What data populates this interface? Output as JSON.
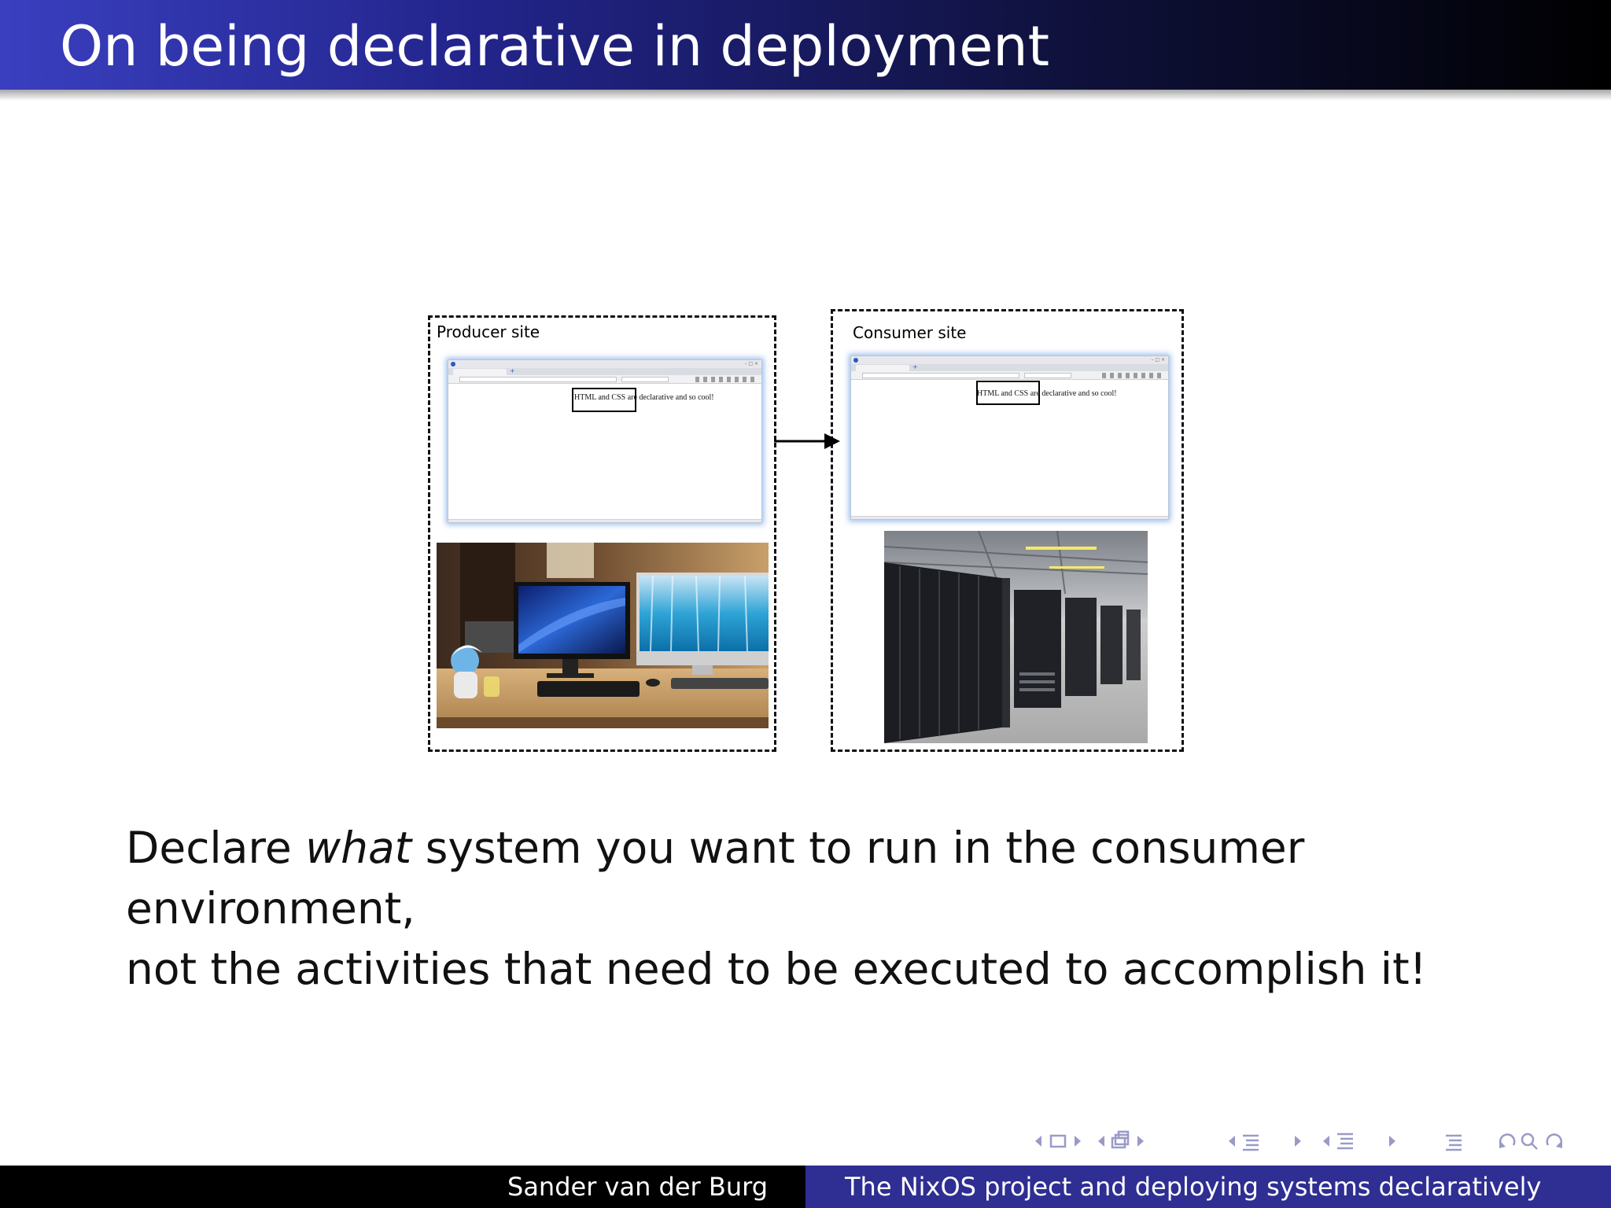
{
  "slide": {
    "title": "On being declarative in deployment"
  },
  "diagram": {
    "producer": {
      "label": "Producer site",
      "browser_text": "HTML and CSS are declarative and so cool!"
    },
    "consumer": {
      "label": "Consumer site",
      "browser_text": "HTML and CSS are declarative and so cool!"
    }
  },
  "statement": {
    "line1_pre": "Declare ",
    "line1_emph": "what",
    "line1_post": " system you want to run in the consumer environment,",
    "line2": "not the activities that need to be executed to accomplish it!"
  },
  "footer": {
    "author": "Sander van der Burg",
    "talk_title": "The NixOS project and deploying systems declaratively"
  },
  "colors": {
    "title_gradient_start": "#3a3fc0",
    "title_gradient_end": "#000000",
    "footer_left": "#000000",
    "footer_right": "#2e2e93",
    "nav_symbols": "#9a9ac8"
  }
}
